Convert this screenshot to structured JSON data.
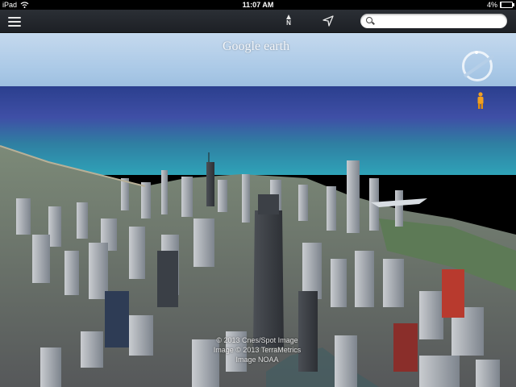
{
  "status_bar": {
    "device": "iPad",
    "time": "11:07 AM",
    "battery": "4%",
    "battery_level": 0.04
  },
  "toolbar": {
    "menu_icon": "hamburger-menu-icon",
    "north_label": "N",
    "north_icon": "north-arrow-icon",
    "locate_icon": "location-arrow-icon",
    "search_placeholder": ""
  },
  "map": {
    "logo_text": "Google earth",
    "attribution": [
      "© 2013 Cnes/Spot Image",
      "Image © 2013 TerraMetrics",
      "Image NOAA"
    ]
  },
  "colors": {
    "toolbar_bg": "#23272c",
    "sky": "#b2cde8",
    "lake": "#3f4fa6",
    "shore_water": "#2fa3b8"
  }
}
